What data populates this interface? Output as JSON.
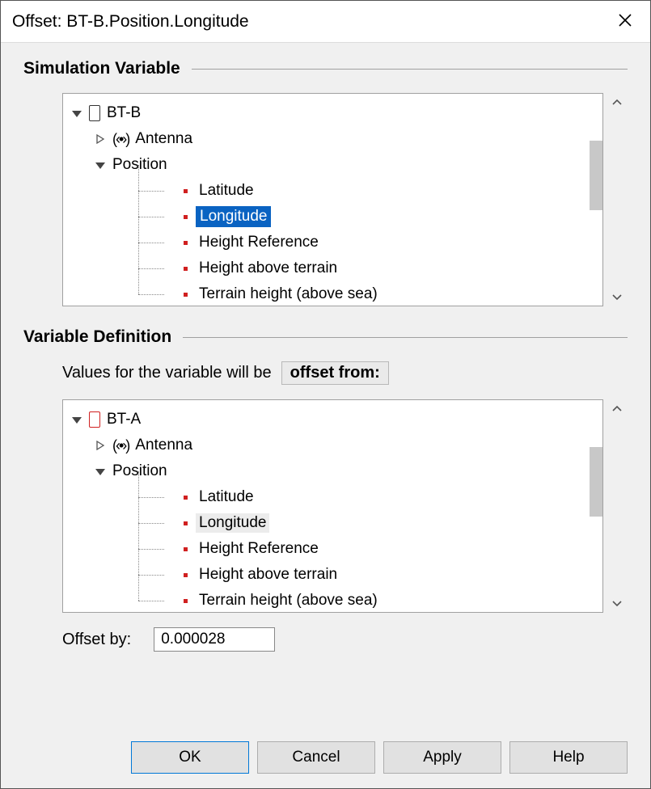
{
  "window": {
    "title": "Offset: BT-B.Position.Longitude"
  },
  "sections": {
    "simulation": {
      "heading": "Simulation Variable"
    },
    "definition": {
      "heading": "Variable Definition"
    }
  },
  "trees": {
    "top": {
      "root": "BT-B",
      "antenna": "Antenna",
      "position": "Position",
      "leaves": [
        "Latitude",
        "Longitude",
        "Height Reference",
        "Height above terrain",
        "Terrain height (above sea)"
      ],
      "selected_index": 1
    },
    "bottom": {
      "root": "BT-A",
      "antenna": "Antenna",
      "position": "Position",
      "leaves": [
        "Latitude",
        "Longitude",
        "Height Reference",
        "Height above terrain",
        "Terrain height (above sea)"
      ],
      "soft_index": 1
    }
  },
  "definition_row": {
    "prefix": "Values for the variable will be",
    "pill": "offset from:"
  },
  "offset": {
    "label": "Offset by:",
    "value": "0.000028"
  },
  "buttons": {
    "ok": "OK",
    "cancel": "Cancel",
    "apply": "Apply",
    "help": "Help"
  }
}
